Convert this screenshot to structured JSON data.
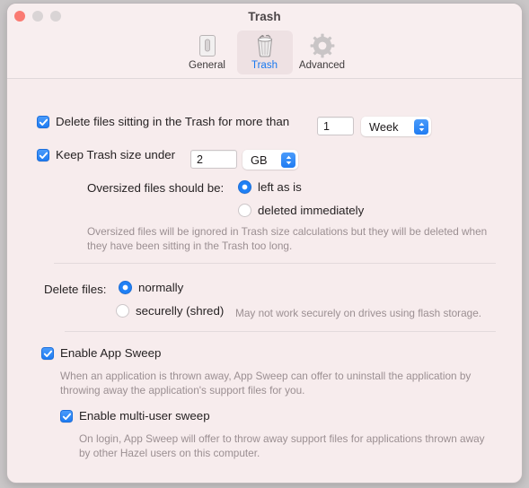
{
  "window": {
    "title": "Trash",
    "traffic_lights": [
      "close-button",
      "minimize-button",
      "maximize-button"
    ]
  },
  "toolbar": {
    "tabs": [
      {
        "label": "General",
        "icon": "switch-icon",
        "selected": false
      },
      {
        "label": "Trash",
        "icon": "trash-icon",
        "selected": true
      },
      {
        "label": "Advanced",
        "icon": "gear-icon",
        "selected": false
      }
    ]
  },
  "main": {
    "delete_old": {
      "checked": true,
      "label": "Delete files sitting in the Trash for more than",
      "amount": "1",
      "unit": "Week"
    },
    "keep_size": {
      "checked": true,
      "label": "Keep Trash size under",
      "amount": "2",
      "unit": "GB"
    },
    "oversized": {
      "label": "Oversized files should be:",
      "options": [
        {
          "label": "left as is",
          "selected": true
        },
        {
          "label": "deleted immediately",
          "selected": false
        }
      ],
      "help_line1": "Oversized files will be ignored in Trash size calculations but they will be deleted when",
      "help_line2": "they have been sitting in the Trash too long."
    },
    "delete_files": {
      "label": "Delete files:",
      "options": [
        {
          "label": "normally",
          "selected": true
        },
        {
          "label": "securelly (shred)",
          "selected": false
        }
      ],
      "note": "May not work securely on drives using flash storage."
    },
    "app_sweep": {
      "checked": true,
      "label": "Enable App Sweep",
      "help_line1": "When an application is thrown away, App Sweep can offer to uninstall the application by",
      "help_line2": "throwing away the application's support files for you."
    },
    "multi_user_sweep": {
      "checked": true,
      "label": "Enable multi-user sweep",
      "help_line1": "On login, App Sweep will offer to throw away support files for applications thrown away",
      "help_line2": "by other Hazel users on this computer."
    }
  },
  "colors": {
    "accent": "#1f7cf2",
    "window_bg": "#f7eced",
    "close": "#fa7a72",
    "help_text": "#9b8f92"
  }
}
